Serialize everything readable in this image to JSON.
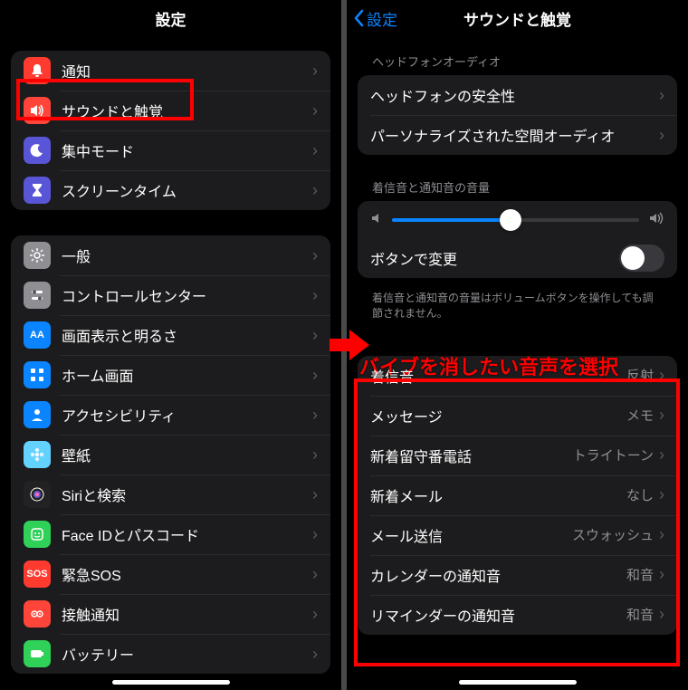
{
  "left": {
    "title": "設定",
    "group1": [
      {
        "label": "通知",
        "icon": "bell",
        "bg": "ic-red"
      },
      {
        "label": "サウンドと触覚",
        "icon": "speaker",
        "bg": "ic-red2",
        "highlight": true
      },
      {
        "label": "集中モード",
        "icon": "moon",
        "bg": "ic-purple"
      },
      {
        "label": "スクリーンタイム",
        "icon": "hourglass",
        "bg": "ic-purple"
      }
    ],
    "group2": [
      {
        "label": "一般",
        "icon": "gear",
        "bg": "ic-gray"
      },
      {
        "label": "コントロールセンター",
        "icon": "switches",
        "bg": "ic-gray"
      },
      {
        "label": "画面表示と明るさ",
        "icon": "AA",
        "bg": "ic-blue",
        "text": true
      },
      {
        "label": "ホーム画面",
        "icon": "grid",
        "bg": "ic-blue"
      },
      {
        "label": "アクセシビリティ",
        "icon": "person",
        "bg": "ic-blue"
      },
      {
        "label": "壁紙",
        "icon": "flower",
        "bg": "ic-teal"
      },
      {
        "label": "Siriと検索",
        "icon": "siri",
        "bg": "ic-dark"
      },
      {
        "label": "Face IDとパスコード",
        "icon": "face",
        "bg": "ic-green"
      },
      {
        "label": "緊急SOS",
        "icon": "SOS",
        "bg": "ic-red",
        "text": true
      },
      {
        "label": "接触通知",
        "icon": "contact",
        "bg": "ic-red2"
      },
      {
        "label": "バッテリー",
        "icon": "battery",
        "bg": "ic-green"
      }
    ]
  },
  "right": {
    "back": "設定",
    "title": "サウンドと触覚",
    "hp_header": "ヘッドフォンオーディオ",
    "hp": [
      {
        "label": "ヘッドフォンの安全性"
      },
      {
        "label": "パーソナライズされた空間オーディオ"
      }
    ],
    "vol_header": "着信音と通知音の音量",
    "vol_toggle_label": "ボタンで変更",
    "vol_footer": "着信音と通知音の音量はボリュームボタンを操作しても調節されません。",
    "annotation": "バイブを消したい音声を選択",
    "sounds": [
      {
        "label": "着信音",
        "value": "反射"
      },
      {
        "label": "メッセージ",
        "value": "メモ"
      },
      {
        "label": "新着留守番電話",
        "value": "トライトーン"
      },
      {
        "label": "新着メール",
        "value": "なし"
      },
      {
        "label": "メール送信",
        "value": "スウォッシュ"
      },
      {
        "label": "カレンダーの通知音",
        "value": "和音"
      },
      {
        "label": "リマインダーの通知音",
        "value": "和音"
      }
    ]
  }
}
